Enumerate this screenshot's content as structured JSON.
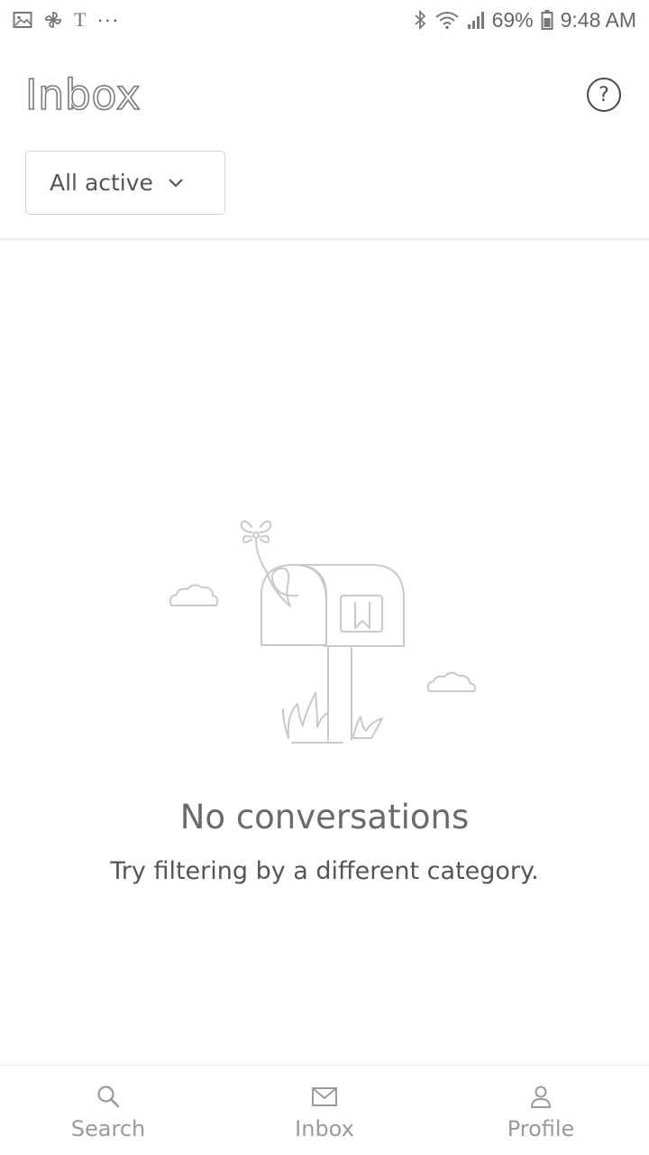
{
  "status_bar": {
    "carrier_glyph": "T",
    "more_glyph": "···",
    "battery_percent": "69%",
    "time": "9:48 AM",
    "icons": [
      "gallery-icon",
      "pinwheel-icon",
      "bluetooth-icon",
      "wifi-icon",
      "signal-icon",
      "battery-icon"
    ]
  },
  "header": {
    "title": "Inbox",
    "help_glyph": "?"
  },
  "filter": {
    "selected": "All active"
  },
  "empty_state": {
    "title": "No conversations",
    "subtitle": "Try filtering by a different category."
  },
  "bottom_nav": {
    "items": [
      {
        "label": "Search",
        "icon": "search-icon"
      },
      {
        "label": "Inbox",
        "icon": "mail-icon"
      },
      {
        "label": "Profile",
        "icon": "person-icon"
      }
    ]
  }
}
